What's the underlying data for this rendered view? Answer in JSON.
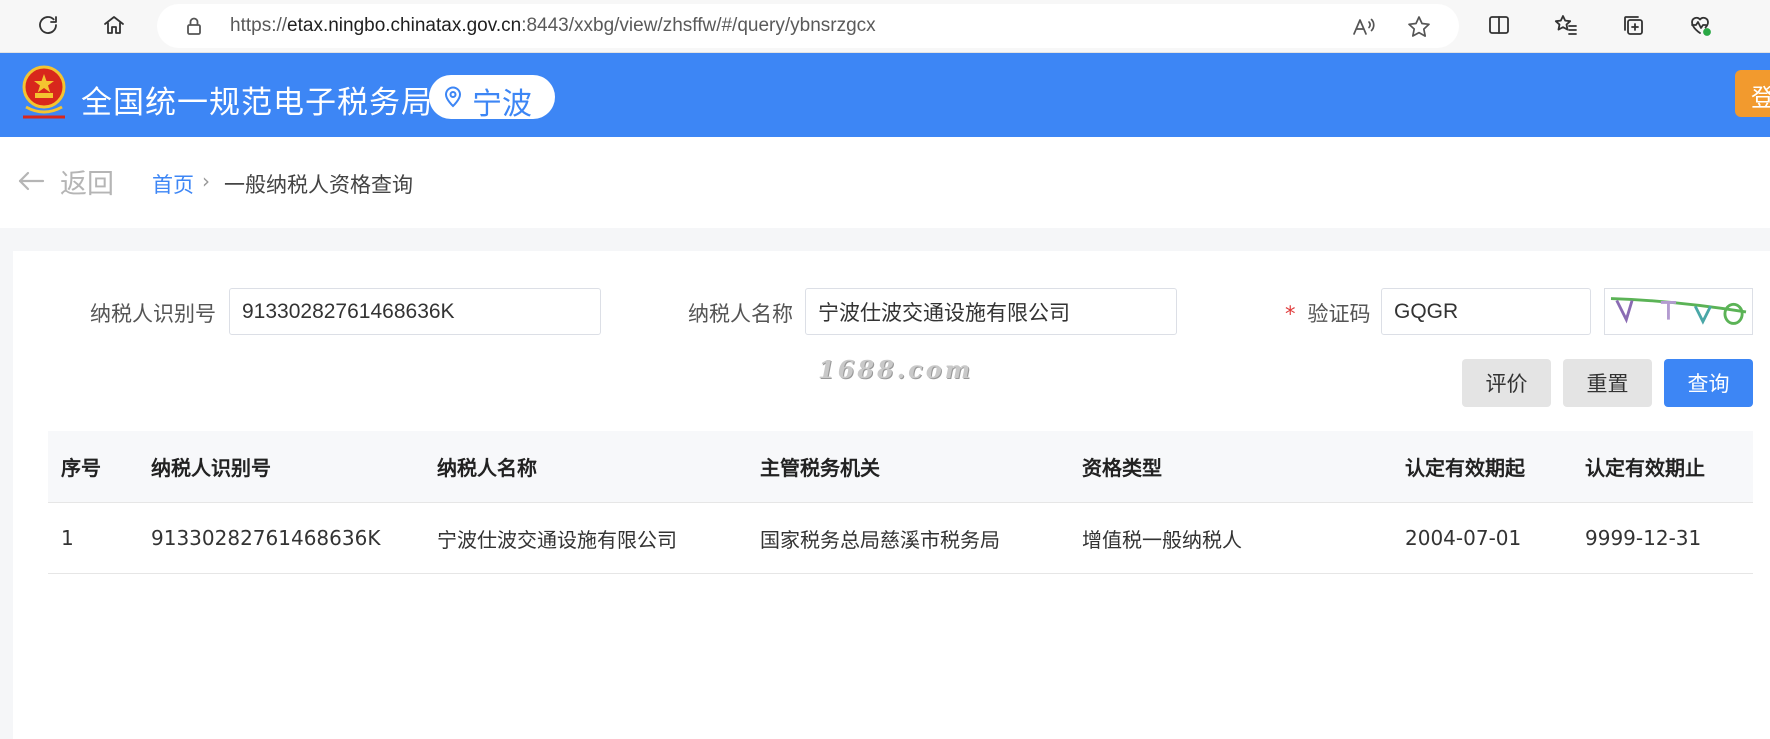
{
  "browser": {
    "url_prefix": "https://",
    "url_host": "etax.ningbo.chinatax.gov.cn",
    "url_rest": ":8443/xxbg/view/zhsffw/#/query/ybnsrzgcx"
  },
  "header": {
    "site_title": "全国统一规范电子税务局",
    "city": "宁波",
    "login_label": "登录",
    "brand_color": "#3d86f5",
    "login_color": "#f29a2e"
  },
  "breadcrumb": {
    "back_label": "返回",
    "home": "首页",
    "separator": "›",
    "current": "一般纳税人资格查询"
  },
  "form": {
    "taxpayer_id_label": "纳税人识别号",
    "taxpayer_id_value": "91330282761468636K",
    "taxpayer_name_label": "纳税人名称",
    "taxpayer_name_value": "宁波仕波交通设施有限公司",
    "required_mark": "*",
    "captcha_label": "验证码",
    "captcha_value": "GQGR",
    "watermark": "1688.com",
    "buttons": {
      "evaluate": "评价",
      "reset": "重置",
      "query": "查询"
    }
  },
  "table": {
    "headers": [
      "序号",
      "纳税人识别号",
      "纳税人名称",
      "主管税务机关",
      "资格类型",
      "认定有效期起",
      "认定有效期止"
    ],
    "rows": [
      [
        "1",
        "91330282761468636K",
        "宁波仕波交通设施有限公司",
        "国家税务总局慈溪市税务局",
        "增值税一般纳税人",
        "2004-07-01",
        "9999-12-31"
      ]
    ]
  }
}
